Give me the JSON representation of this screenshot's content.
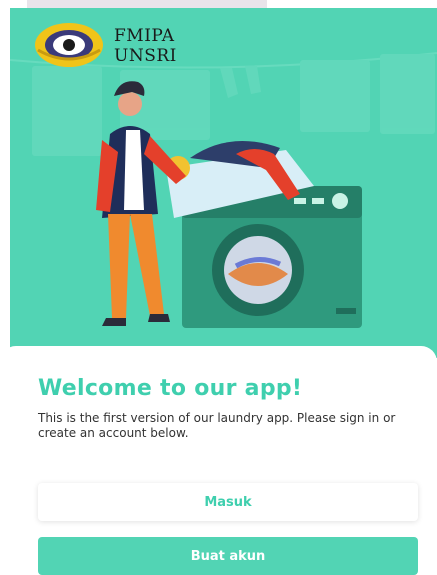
{
  "header": {
    "logo_line1": "FMIPA",
    "logo_line2": "UNSRI"
  },
  "welcome": {
    "title": "Welcome to our app!",
    "description": "This is the first version of our laundry app. Please sign in or create an account below."
  },
  "actions": {
    "login_label": "Masuk",
    "register_label": "Buat akun"
  },
  "colors": {
    "accent": "#52d4b4",
    "accent_text": "#3fcfae",
    "text": "#333333",
    "background": "#ffffff"
  },
  "icons": {
    "logo": "university-emblem-icon",
    "illustration": "laundry-illustration"
  }
}
